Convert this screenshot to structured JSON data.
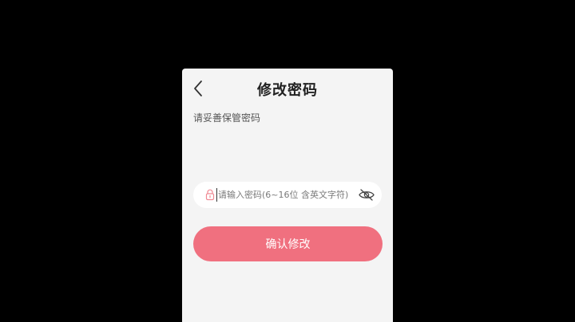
{
  "header": {
    "title": "修改密码",
    "back_icon": "chevron-left-icon"
  },
  "subtitle": "请妥善保管密码",
  "password_field": {
    "placeholder": "请输入密码(6~16位 含英文字符)",
    "value": "",
    "lock_icon": "lock-icon",
    "visibility_icon": "eye-closed-icon"
  },
  "confirm_button": {
    "label": "确认修改"
  },
  "colors": {
    "background": "#000000",
    "card": "#f4f4f4",
    "accent": "#f0707f",
    "lock_icon": "#f08a94"
  }
}
